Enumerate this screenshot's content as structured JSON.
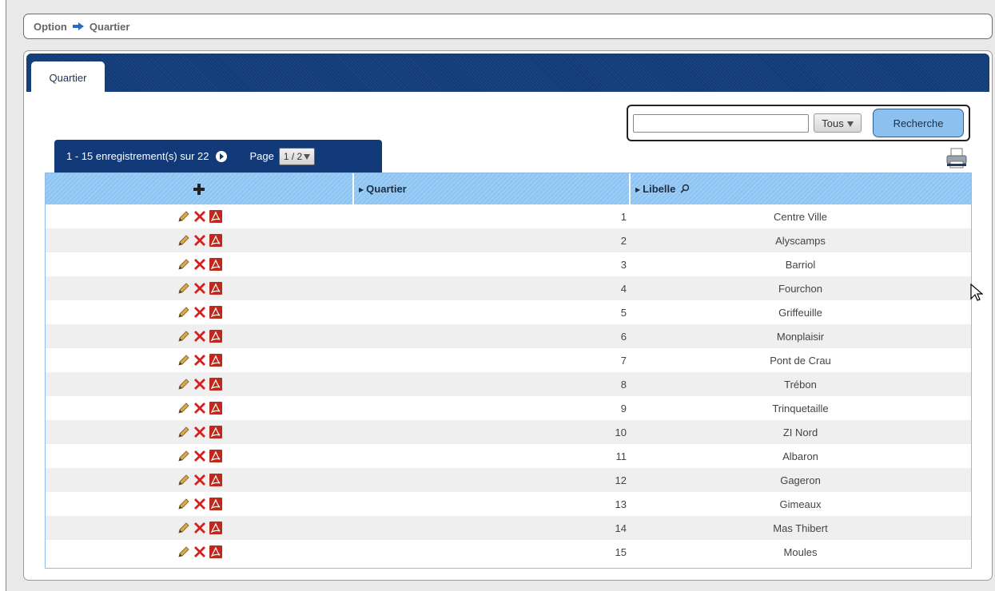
{
  "breadcrumb": {
    "items": [
      "Option",
      "Quartier"
    ]
  },
  "tabs": [
    {
      "label": "Quartier"
    }
  ],
  "search": {
    "value": "",
    "filter": "Tous",
    "button_label": "Recherche"
  },
  "pager": {
    "summary": "1 - 15 enregistrement(s) sur 22",
    "page_label": "Page",
    "page_value": "1 / 2"
  },
  "table": {
    "columns": [
      "",
      "Quartier",
      "Libelle"
    ],
    "rows": [
      {
        "quartier": "1",
        "libelle": "Centre Ville"
      },
      {
        "quartier": "2",
        "libelle": "Alyscamps"
      },
      {
        "quartier": "3",
        "libelle": "Barriol"
      },
      {
        "quartier": "4",
        "libelle": "Fourchon"
      },
      {
        "quartier": "5",
        "libelle": "Griffeuille"
      },
      {
        "quartier": "6",
        "libelle": "Monplaisir"
      },
      {
        "quartier": "7",
        "libelle": "Pont de Crau"
      },
      {
        "quartier": "8",
        "libelle": "Trébon"
      },
      {
        "quartier": "9",
        "libelle": "Trinquetaille"
      },
      {
        "quartier": "10",
        "libelle": "ZI Nord"
      },
      {
        "quartier": "11",
        "libelle": "Albaron"
      },
      {
        "quartier": "12",
        "libelle": "Gageron"
      },
      {
        "quartier": "13",
        "libelle": "Gimeaux"
      },
      {
        "quartier": "14",
        "libelle": "Mas Thibert"
      },
      {
        "quartier": "15",
        "libelle": "Moules"
      }
    ]
  },
  "icons": {
    "breadcrumb_separator": "arrow-right-icon",
    "add": "plus-icon",
    "row_actions": [
      "pencil-icon",
      "delete-icon",
      "pdf-icon"
    ],
    "sort": "triangle-right-icon",
    "search_column": "magnifier-icon",
    "next_page": "next-page-icon",
    "print": "printer-icon"
  },
  "colors": {
    "tabbar": "#113b78",
    "header": "#8ec5f3",
    "search_button": "#8cc0ee",
    "delete": "#d62020",
    "pdf": "#c0281c"
  }
}
